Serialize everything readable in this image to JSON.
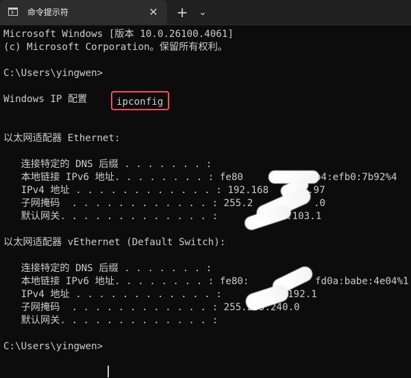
{
  "window": {
    "tab_title": "命令提示符",
    "close_glyph": "✕",
    "new_tab_glyph": "+",
    "dropdown_glyph": "⌄"
  },
  "terminal": {
    "header_line_1": "Microsoft Windows [版本 10.0.26100.4061]",
    "header_line_2": "(c) Microsoft Corporation。保留所有权利。",
    "prompt_1": "C:\\Users\\yingwen>",
    "command": "ipconfig",
    "windows_ip_config": "Windows IP 配置",
    "adapter_1_heading": "以太网适配器 Ethernet:",
    "adapter_1": {
      "dns_suffix": "   连接特定的 DNS 后缀 . . . . . . . :",
      "ipv6": "   本地链接 IPv6 地址. . . . . . . . : fe80",
      "ipv6_tail": "b4:efb0:7b92%4",
      "ipv4": "   IPv4 地址 . . . . . . . . . . . . : 192.168",
      "ipv4_tail": ".97",
      "subnet": "   子网掩码  . . . . . . . . . . . . : 255.2",
      "subnet_tail": ".0",
      "gateway": "   默认网关. . . . . . . . . . . . . :",
      "gateway_tail": ".103.1"
    },
    "adapter_2_heading": "以太网适配器 vEthernet (Default Switch):",
    "adapter_2": {
      "dns_suffix": "   连接特定的 DNS 后缀 . . . . . . . :",
      "ipv6": "   本地链接 IPv6 地址. . . . . . . . : fe80:",
      "ipv6_tail": "fd0a:babe:4e04%1",
      "ipv4": "   IPv4 地址 . . . . . . . . . . . . :",
      "ipv4_tail": "192.1",
      "subnet": "   子网掩码  . . . . . . . . . . . . : 255.255.240.0",
      "gateway": "   默认网关. . . . . . . . . . . . . :"
    },
    "prompt_2": "C:\\Users\\yingwen>"
  }
}
